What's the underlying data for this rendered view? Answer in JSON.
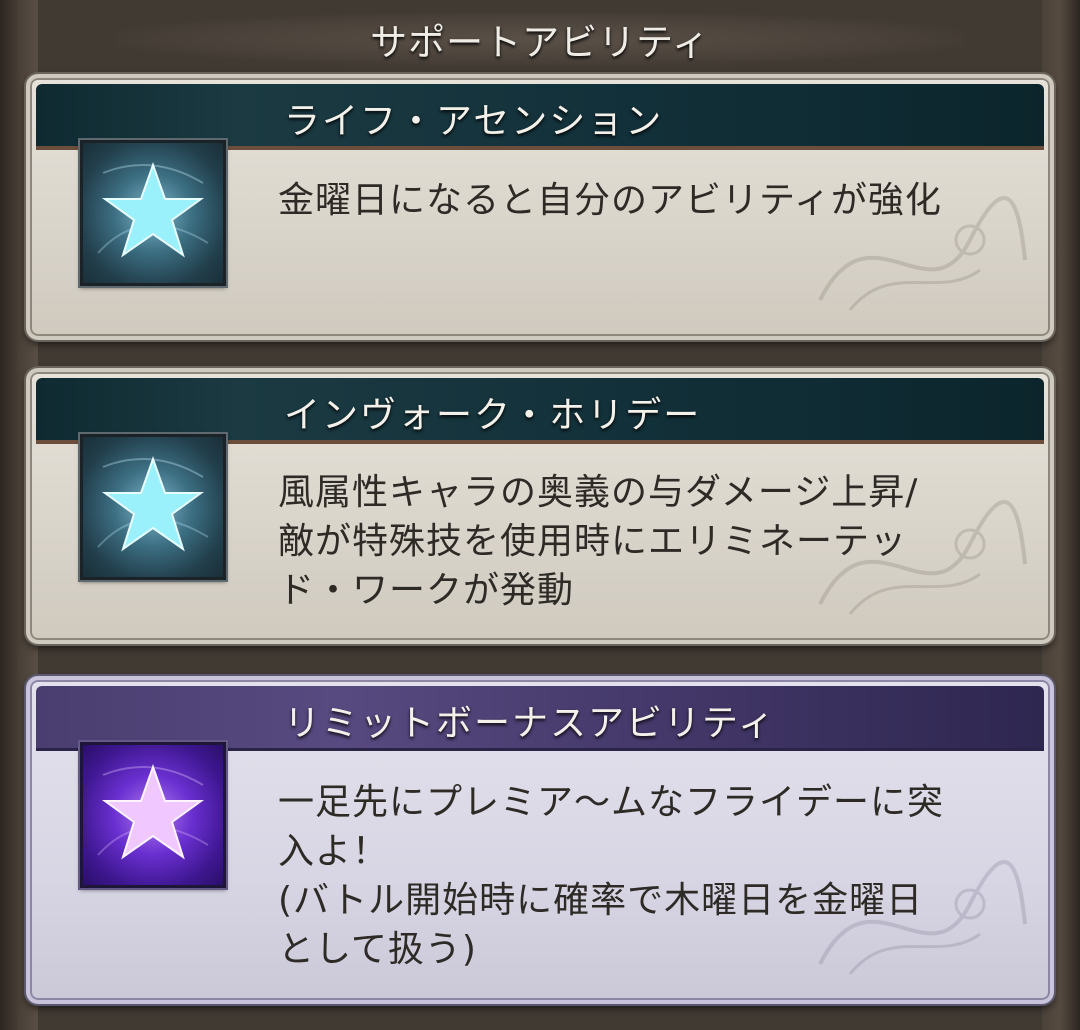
{
  "header": {
    "title": "サポートアビリティ"
  },
  "abilities": [
    {
      "name": "ライフ・アセンション",
      "description": "金曜日になると自分のアビリティが強化",
      "icon": "star-icon",
      "color": "#7fe3f5"
    },
    {
      "name": "インヴォーク・ホリデー",
      "description": "風属性キャラの奥義の与ダメージ上昇/\n敵が特殊技を使用時にエリミネーテッ\nド・ワークが発動",
      "icon": "star-icon",
      "color": "#7fe3f5"
    },
    {
      "name": "リミットボーナスアビリティ",
      "description": "一足先にプレミア～ムなフライデーに突\n入よ！\n(バトル開始時に確率で木曜日を金曜日\nとして扱う)",
      "icon": "star-icon",
      "color": "#e3b8ff"
    }
  ]
}
